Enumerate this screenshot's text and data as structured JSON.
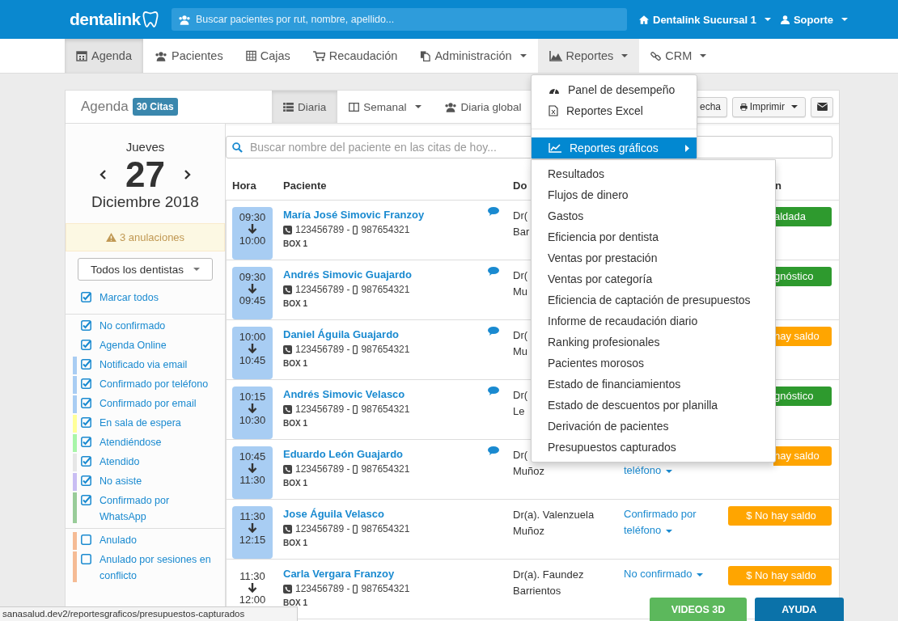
{
  "top_bar": {
    "logo": "dentalink",
    "search": {
      "placeholder": "Buscar pacientes por rut, nombre, apellido..."
    },
    "branch": "Dentalink Sucursal 1",
    "user": "Soporte"
  },
  "nav": [
    {
      "label": "Agenda",
      "selected": true,
      "dropdown": false
    },
    {
      "label": "Pacientes",
      "selected": false,
      "dropdown": false
    },
    {
      "label": "Cajas",
      "selected": false,
      "dropdown": false
    },
    {
      "label": "Recaudación",
      "selected": false,
      "dropdown": false
    },
    {
      "label": "Administración",
      "selected": false,
      "dropdown": true
    },
    {
      "label": "Reportes",
      "selected": false,
      "dropdown": true,
      "expanded": true
    },
    {
      "label": "CRM",
      "selected": false,
      "dropdown": true
    }
  ],
  "agenda": {
    "title": "Agenda",
    "count": "30 Citas",
    "views": [
      {
        "label": "Diaria",
        "selected": true,
        "dropdown": false
      },
      {
        "label": "Semanal",
        "selected": false,
        "dropdown": true
      },
      {
        "label": "Diaria global",
        "selected": false,
        "dropdown": false
      }
    ],
    "actions": [
      {
        "kind": "partial",
        "label": "echa"
      },
      {
        "kind": "print",
        "label": "Imprimir"
      },
      {
        "kind": "mail"
      }
    ]
  },
  "date": {
    "weekday": "Jueves",
    "day": "27",
    "month": "Diciembre",
    "year": "2018"
  },
  "alert": "3 anulaciones",
  "dentist_select": {
    "value": "Todos los dentistas"
  },
  "mark_all": {
    "label": "Marcar todos",
    "checked": true
  },
  "filters": [
    {
      "label": "No confirmado",
      "checked": true
    },
    {
      "label": "Agenda Online",
      "checked": true
    },
    {
      "label": "Notificado via email",
      "checked": true,
      "color": "#a9cdf3"
    },
    {
      "label": "Confirmado por teléfono",
      "checked": true,
      "color": "#a9cdf3"
    },
    {
      "label": "Confirmado por email",
      "checked": true,
      "color": "#a9cdf3"
    },
    {
      "label": "En sala de espera",
      "checked": true,
      "color": "#ffff99"
    },
    {
      "label": "Atendiéndose",
      "checked": true,
      "color": "#a8f5a8"
    },
    {
      "label": "Atendido",
      "checked": true,
      "color": "#e6e6e6"
    },
    {
      "label": "No asiste",
      "checked": true,
      "color": "#c9bdf3"
    },
    {
      "label": "Confirmado por WhatsApp",
      "checked": true,
      "color": "#99cc99"
    }
  ],
  "cancelled_filters": [
    {
      "label": "Anulado",
      "checked": false,
      "color": "#f5bb95"
    },
    {
      "label": "Anulado por sesiones en conflicto",
      "checked": false,
      "color": "#f5bb95"
    }
  ],
  "search": {
    "placeholder": "Buscar nombre del paciente en las citas de hoy..."
  },
  "table": {
    "columns": [
      "Hora",
      "Paciente",
      "Do",
      "n"
    ],
    "rows": [
      {
        "start": "09:30",
        "end": "10:00",
        "highlighted": true,
        "patient": "María José Simovic Franzoy",
        "phone": "123456789 -",
        "mobile": "987654321",
        "box": "BOX 1",
        "has_comment": true,
        "doctor_lines": [
          "Dr(",
          "Bar"
        ],
        "badge": {
          "text": "aldada",
          "color": "#2e9a2e",
          "partial": true
        }
      },
      {
        "start": "09:30",
        "end": "09:45",
        "highlighted": true,
        "patient": "Andrés Simovic Guajardo",
        "phone": "123456789 -",
        "mobile": "987654321",
        "box": "BOX 1",
        "has_comment": true,
        "doctor_lines": [
          "Dr(",
          "Mu"
        ],
        "badge": {
          "text": "gnóstico",
          "color": "#2e9a2e",
          "partial": true
        }
      },
      {
        "start": "10:00",
        "end": "10:45",
        "highlighted": true,
        "patient": "Daniel Águila Guajardo",
        "phone": "123456789 -",
        "mobile": "987654321",
        "box": "BOX 1",
        "has_comment": true,
        "doctor_lines": [
          "Dr(",
          "Mu"
        ],
        "badge": {
          "text": "hay saldo",
          "color": "#ffa500",
          "partial": true
        }
      },
      {
        "start": "10:15",
        "end": "10:30",
        "highlighted": true,
        "patient": "Andrés Simovic Velasco",
        "phone": "123456789 -",
        "mobile": "987654321",
        "box": "BOX 1",
        "has_comment": true,
        "doctor_lines": [
          "Dr(",
          "Le"
        ],
        "badge": {
          "text": "gnóstico",
          "color": "#2e9a2e",
          "partial": true
        }
      },
      {
        "start": "10:45",
        "end": "11:30",
        "highlighted": true,
        "patient": "Eduardo León Guajardo",
        "phone": "123456789 -",
        "mobile": "987654321",
        "box": "BOX 1",
        "has_comment": true,
        "doctor_lines": [
          "Dr(",
          "Muñoz"
        ],
        "estado": {
          "text": "teléfono",
          "kind": "continued"
        },
        "badge": {
          "text": "hay saldo",
          "color": "#ffa500",
          "partial": true
        }
      },
      {
        "start": "11:30",
        "end": "12:15",
        "highlighted": true,
        "patient": "Jose Águila Velasco",
        "phone": "123456789 -",
        "mobile": "987654321",
        "box": "BOX 1",
        "has_comment": false,
        "doctor_lines": [
          "Dr(a). Valenzuela",
          "Muñoz"
        ],
        "estado": {
          "text": "Confirmado por teléfono",
          "kind": "full"
        },
        "badge": {
          "text": "$ No hay saldo",
          "color": "#ffa500",
          "partial": false
        }
      },
      {
        "start": "11:30",
        "end": "12:00",
        "highlighted": false,
        "patient": "Carla Vergara Franzoy",
        "phone": "123456789 -",
        "mobile": "987654321",
        "box": "BOX 1",
        "has_comment": false,
        "doctor_lines": [
          "Dr(a). Faundez",
          "Barrientos"
        ],
        "estado": {
          "text": "No confirmado",
          "kind": "full"
        },
        "badge": {
          "text": "$ No hay saldo",
          "color": "#ffa500",
          "partial": false
        }
      }
    ]
  },
  "reportes_menu": [
    {
      "label": "Panel de desempeño",
      "selected": false,
      "submenu": false
    },
    {
      "label": "Reportes Excel",
      "selected": false,
      "submenu": false
    },
    {
      "label": "Reportes gráficos",
      "selected": true,
      "submenu": true
    }
  ],
  "submenu": [
    "Resultados",
    "Flujos de dinero",
    "Gastos",
    "Eficiencia por dentista",
    "Ventas por prestación",
    "Ventas por categoría",
    "Eficiencia de captación de presupuestos",
    "Informe de recaudación diario",
    "Ranking profesionales",
    "Pacientes morosos",
    "Estado de financiamientos",
    "Estado de descuentos por planilla",
    "Derivación de pacientes",
    "Presupuestos capturados"
  ],
  "status_url": "sanasalud.dev2/reportesgraficos/presupuestos-capturados",
  "floating_buttons": [
    "VIDEOS 3D",
    "AYUDA"
  ]
}
